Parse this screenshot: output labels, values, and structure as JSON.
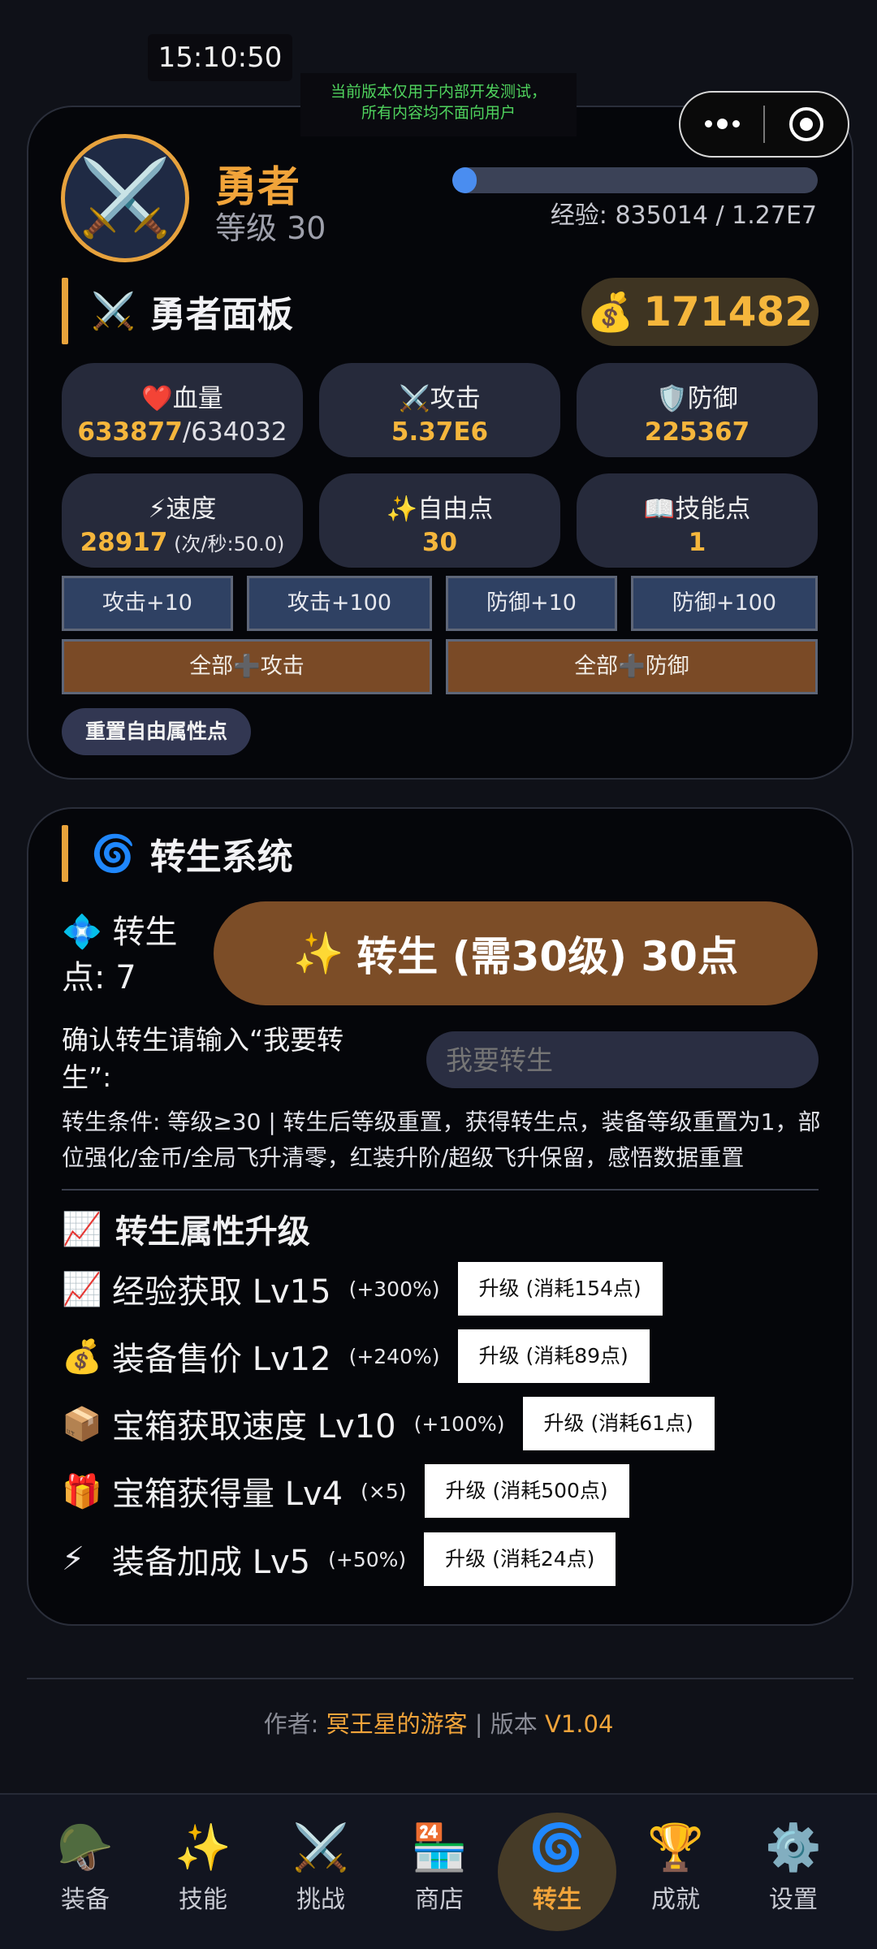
{
  "status": {
    "time": "15:10:50"
  },
  "notice": {
    "line1": "当前版本仅用于内部开发测试，",
    "line2": "所有内容均不面向用户"
  },
  "hero": {
    "avatar_icon": "crossed-swords-icon",
    "name": "勇者",
    "level": "等级 30",
    "exp_progress": 0.066,
    "exp_text": "经验: 835014 / 1.27E7"
  },
  "panel": {
    "title": "勇者面板",
    "gold": "171482",
    "stats": [
      {
        "label": "❤️血量",
        "value": "633877",
        "value_sub": "/634032"
      },
      {
        "label": "⚔️攻击",
        "value": "5.37E6",
        "value_sub": ""
      },
      {
        "label": "🛡️防御",
        "value": "225367",
        "value_sub": ""
      },
      {
        "label": "⚡速度",
        "value": "28917",
        "value_sub": " (次/秒:50.0)"
      },
      {
        "label": "✨自由点",
        "value": "30",
        "value_sub": ""
      },
      {
        "label": "📖技能点",
        "value": "1",
        "value_sub": ""
      }
    ],
    "buttons": {
      "atk10": "攻击+10",
      "atk100": "攻击+100",
      "def10": "防御+10",
      "def100": "防御+100",
      "all_atk": "全部➕攻击",
      "all_def": "全部➕防御",
      "reset": "重置自由属性点"
    }
  },
  "rebirth": {
    "title": "转生系统",
    "points_label": "转生点: 7",
    "button": "转生 (需30级) 30点",
    "confirm_label": "确认转生请输入“我要转生”:",
    "input_placeholder": "我要转生",
    "condition": "转生条件: 等级≥30 | 转生后等级重置，获得转生点，装备等级重置为1，部位强化/金币/全局飞升清零，红装升阶/超级飞升保留，感悟数据重置",
    "upgrade_title": "转生属性升级",
    "upgrades": [
      {
        "icon": "📈",
        "name": "经验获取 Lv15",
        "bonus": "(+300%)",
        "button": "升级 (消耗154点)"
      },
      {
        "icon": "💰",
        "name": "装备售价 Lv12",
        "bonus": "(+240%)",
        "button": "升级 (消耗89点)"
      },
      {
        "icon": "📦",
        "name": "宝箱获取速度 Lv10",
        "bonus": "(+100%)",
        "button": "升级 (消耗61点)"
      },
      {
        "icon": "🎁",
        "name": "宝箱获得量 Lv4",
        "bonus": "(×5)",
        "button": "升级 (消耗500点)"
      },
      {
        "icon": "⚡",
        "name": "装备加成 Lv5",
        "bonus": "(+50%)",
        "button": "升级 (消耗24点)"
      }
    ]
  },
  "footer": {
    "author_label": "作者: ",
    "author": "冥王星的游客",
    "version_label": " | 版本 ",
    "version": "V1.04"
  },
  "tabs": [
    {
      "icon": "🪖",
      "label": "装备"
    },
    {
      "icon": "✨",
      "label": "技能"
    },
    {
      "icon": "⚔️",
      "label": "挑战"
    },
    {
      "icon": "🏪",
      "label": "商店"
    },
    {
      "icon": "🌀",
      "label": "转生"
    },
    {
      "icon": "🏆",
      "label": "成就"
    },
    {
      "icon": "⚙️",
      "label": "设置"
    }
  ],
  "colors": {
    "accent": "#f1a43a",
    "card_bg": "#05060a",
    "stat_bg": "#262a3b",
    "btn_brown": "#7a4a26"
  }
}
